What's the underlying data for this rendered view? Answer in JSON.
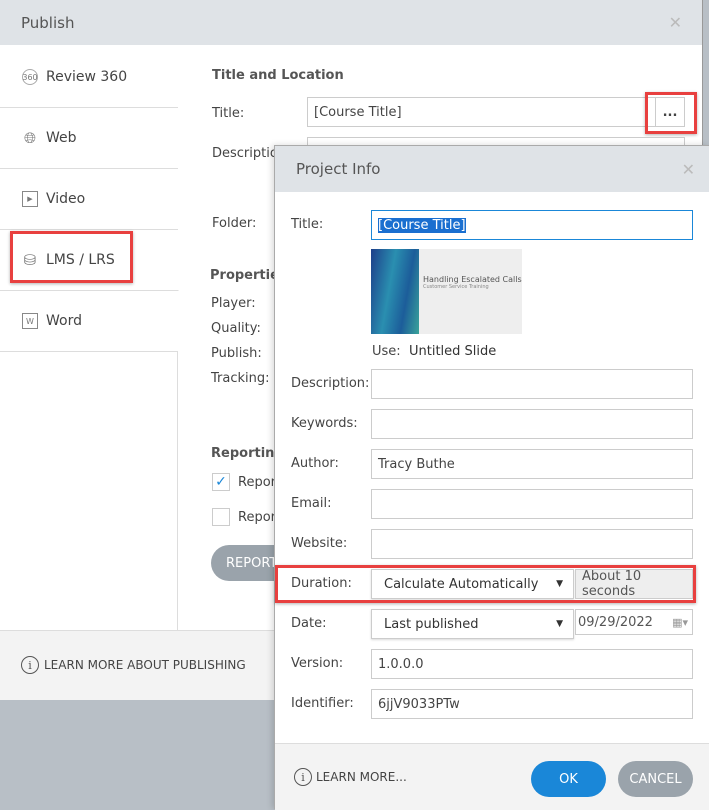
{
  "publish": {
    "title": "Publish",
    "sidebar": [
      {
        "label": "Review 360",
        "icon": "review-360-icon"
      },
      {
        "label": "Web",
        "icon": "globe-icon"
      },
      {
        "label": "Video",
        "icon": "video-icon"
      },
      {
        "label": "LMS / LRS",
        "icon": "database-icon",
        "selected": true
      },
      {
        "label": "Word",
        "icon": "word-document-icon"
      }
    ],
    "title_location_heading": "Title and Location",
    "title_label": "Title:",
    "title_value": "[Course Title]",
    "browse_label": "...",
    "description_label": "Description:",
    "folder_label": "Folder:",
    "properties_heading": "Properties",
    "player_label": "Player:",
    "quality_label": "Quality:",
    "publish_label": "Publish:",
    "tracking_label": "Tracking:",
    "reporting_heading": "Reporting",
    "report_option_1": "Report",
    "report_option_2": "Report",
    "report_button": "REPORT",
    "learn_more": "LEARN MORE ABOUT PUBLISHING"
  },
  "project_info": {
    "title": "Project Info",
    "fields": {
      "title_label": "Title:",
      "title_value": "[Course Title]",
      "thumb_title": "Handling Escalated Calls",
      "thumb_subtitle": "Customer Service Training",
      "use_label": "Use:",
      "use_value": "Untitled Slide",
      "description_label": "Description:",
      "description_value": "",
      "keywords_label": "Keywords:",
      "keywords_value": "",
      "author_label": "Author:",
      "author_value": "Tracy Buthe",
      "email_label": "Email:",
      "email_value": "",
      "website_label": "Website:",
      "website_value": "",
      "duration_label": "Duration:",
      "duration_mode": "Calculate Automatically",
      "duration_value": "About 10 seconds",
      "date_label": "Date:",
      "date_mode": "Last published",
      "date_value": "09/29/2022",
      "version_label": "Version:",
      "version_value": "1.0.0.0",
      "identifier_label": "Identifier:",
      "identifier_value": "6jjV9033PTw"
    },
    "learn_more": "LEARN MORE...",
    "ok": "OK",
    "cancel": "CANCEL",
    "colors": {
      "ok": "#1a87d8",
      "cancel": "#9aa3ab",
      "highlight": "#e8403f"
    }
  }
}
